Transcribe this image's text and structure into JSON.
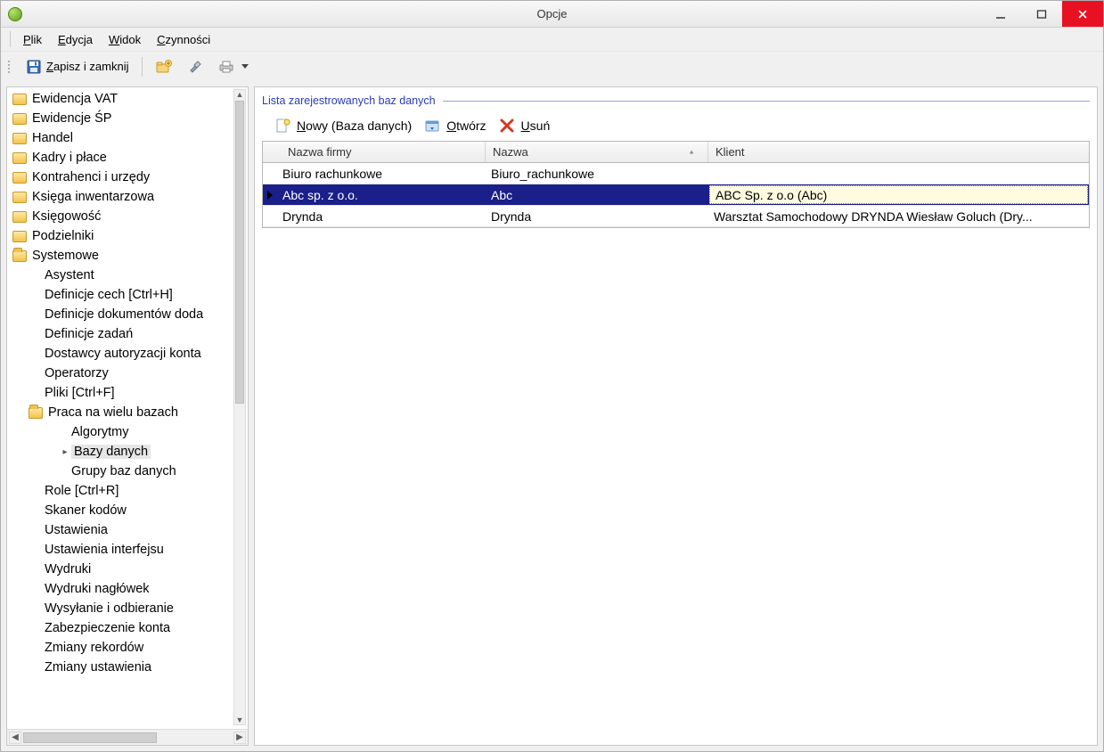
{
  "window": {
    "title": "Opcje"
  },
  "menubar": {
    "plik_pre": "P",
    "plik_rest": "lik",
    "edycja_pre": "E",
    "edycja_rest": "dycja",
    "widok_pre": "W",
    "widok_rest": "idok",
    "czynnosci_pre": "C",
    "czynnosci_rest": "zynności"
  },
  "toolbar": {
    "zapisz_pre": "Z",
    "zapisz_rest": "apisz i zamknij"
  },
  "tree": {
    "items": [
      {
        "label": "Ewidencja VAT",
        "depth": 1,
        "folder": true
      },
      {
        "label": "Ewidencje ŚP",
        "depth": 1,
        "folder": true
      },
      {
        "label": "Handel",
        "depth": 1,
        "folder": true
      },
      {
        "label": "Kadry i płace",
        "depth": 1,
        "folder": true
      },
      {
        "label": "Kontrahenci i urzędy",
        "depth": 1,
        "folder": true
      },
      {
        "label": "Księga inwentarzowa",
        "depth": 1,
        "folder": true
      },
      {
        "label": "Księgowość",
        "depth": 1,
        "folder": true
      },
      {
        "label": "Podzielniki",
        "depth": 1,
        "folder": true
      },
      {
        "label": "Systemowe",
        "depth": 1,
        "folder": true,
        "open": true
      },
      {
        "label": "Asystent",
        "depth": 3,
        "folder": false
      },
      {
        "label": "Definicje cech [Ctrl+H]",
        "depth": 3,
        "folder": false
      },
      {
        "label": "Definicje dokumentów doda",
        "depth": 3,
        "folder": false
      },
      {
        "label": "Definicje zadań",
        "depth": 3,
        "folder": false
      },
      {
        "label": "Dostawcy autoryzacji konta",
        "depth": 3,
        "folder": false
      },
      {
        "label": "Operatorzy",
        "depth": 3,
        "folder": false
      },
      {
        "label": "Pliki [Ctrl+F]",
        "depth": 3,
        "folder": false
      },
      {
        "label": "Praca na wielu bazach",
        "depth": 2,
        "folder": true,
        "open": true
      },
      {
        "label": "Algorytmy",
        "depth": 4,
        "folder": false
      },
      {
        "label": "Bazy danych",
        "depth": 4,
        "folder": false,
        "selected": true,
        "pointer": true
      },
      {
        "label": "Grupy baz danych",
        "depth": 4,
        "folder": false
      },
      {
        "label": "Role [Ctrl+R]",
        "depth": 3,
        "folder": false
      },
      {
        "label": "Skaner kodów",
        "depth": 3,
        "folder": false
      },
      {
        "label": "Ustawienia",
        "depth": 3,
        "folder": false
      },
      {
        "label": "Ustawienia interfejsu",
        "depth": 3,
        "folder": false
      },
      {
        "label": "Wydruki",
        "depth": 3,
        "folder": false
      },
      {
        "label": "Wydruki nagłówek",
        "depth": 3,
        "folder": false
      },
      {
        "label": "Wysyłanie i odbieranie",
        "depth": 3,
        "folder": false
      },
      {
        "label": "Zabezpieczenie konta",
        "depth": 3,
        "folder": false
      },
      {
        "label": "Zmiany rekordów",
        "depth": 3,
        "folder": false
      },
      {
        "label": "Zmiany ustawienia",
        "depth": 3,
        "folder": false
      }
    ]
  },
  "right": {
    "group_title": "Lista zarejestrowanych baz danych",
    "nowy_pre": "N",
    "nowy_rest": "owy (Baza danych)",
    "otworz_pre": "O",
    "otworz_rest": "twórz",
    "usun_pre": "U",
    "usun_rest": "suń",
    "columns": {
      "c1": "Nazwa firmy",
      "c2": "Nazwa",
      "c3": "Klient"
    },
    "rows": [
      {
        "c1": "Biuro rachunkowe",
        "c2": "Biuro_rachunkowe",
        "c3": ""
      },
      {
        "c1": "Abc sp. z o.o.",
        "c2": "Abc",
        "c3": "ABC Sp. z o.o (Abc)",
        "selected": true
      },
      {
        "c1": "Drynda",
        "c2": "Drynda",
        "c3": "Warsztat Samochodowy DRYNDA Wiesław Goluch (Dry..."
      }
    ]
  }
}
